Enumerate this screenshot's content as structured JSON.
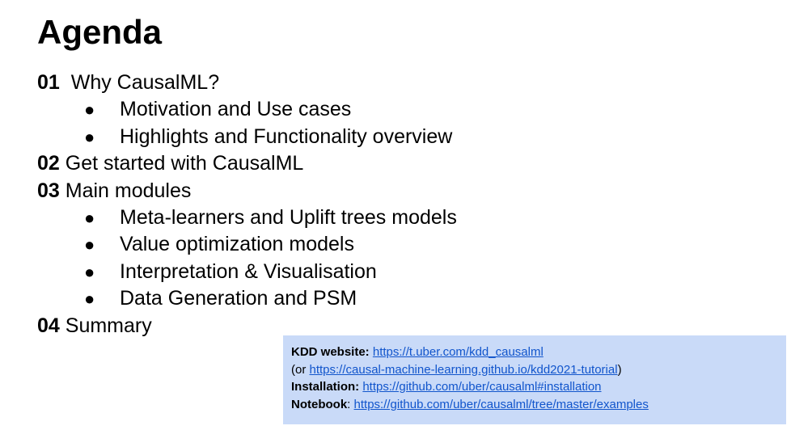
{
  "slide": {
    "title": "Agenda",
    "items": [
      {
        "num": "01",
        "text": "Why CausalML?",
        "sub": [
          "Motivation and Use cases",
          "Highlights and Functionality overview"
        ]
      },
      {
        "num": "02",
        "text": "Get started with CausalML",
        "sub": []
      },
      {
        "num": "03",
        "text": "Main modules",
        "sub": [
          "Meta-learners and Uplift trees models",
          "Value optimization models",
          "Interpretation & Visualisation",
          "Data Generation and PSM"
        ]
      },
      {
        "num": "04",
        "text": "Summary",
        "sub": []
      }
    ],
    "bullet_glyph": "●"
  },
  "infobox": {
    "background": "#c9daf8",
    "link_color": "#1155cc",
    "kdd_label": "KDD website:",
    "kdd_url": "https://t.uber.com/kdd_causalml",
    "or_prefix": "(or ",
    "alt_url": "https://causal-machine-learning.github.io/kdd2021-tutorial",
    "or_suffix": ")",
    "install_label": "Installation:",
    "install_url": "https://github.com/uber/causalml#installation",
    "notebook_label": "Notebook",
    "notebook_sep": ": ",
    "notebook_url": "https://github.com/uber/causalml/tree/master/examples"
  }
}
